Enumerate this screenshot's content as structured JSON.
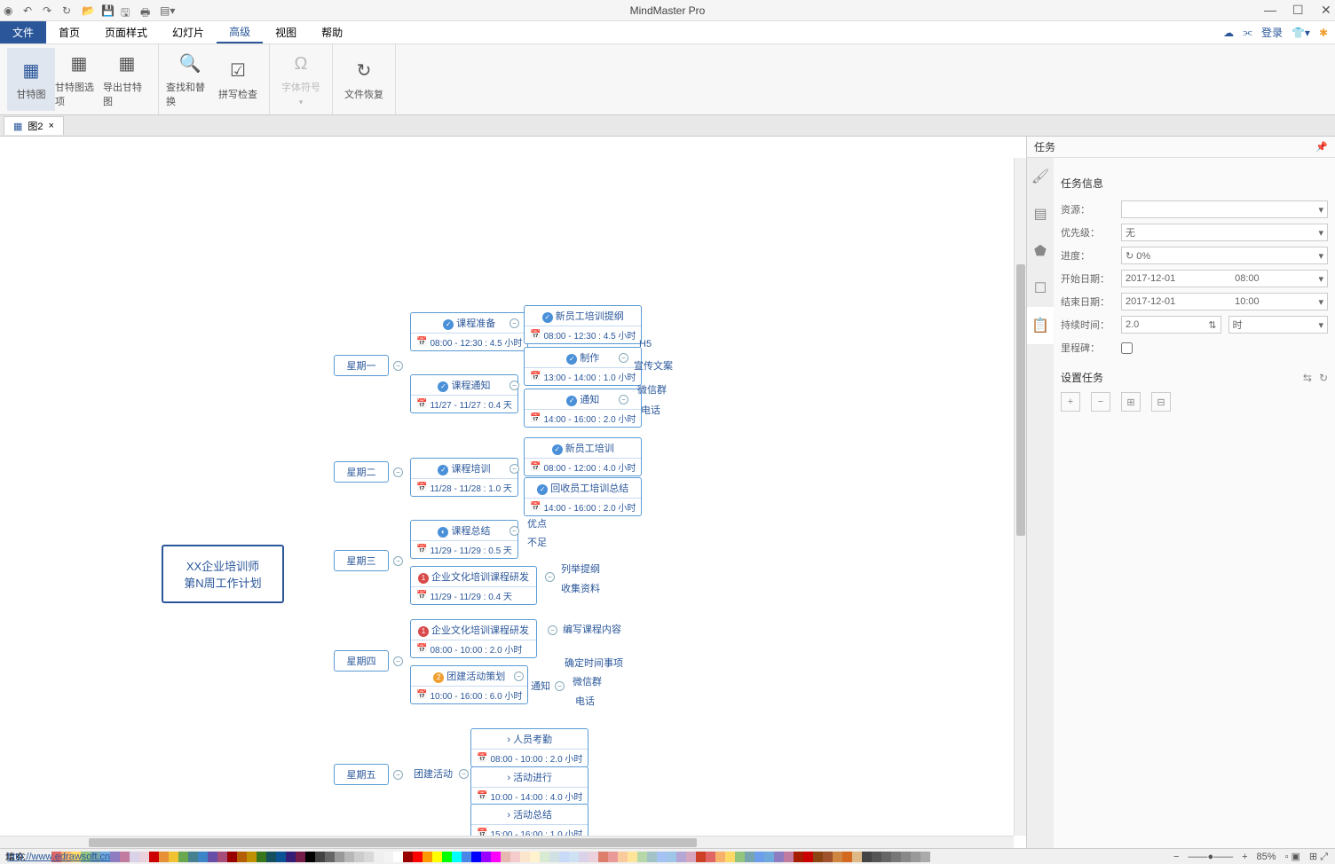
{
  "app_title": "MindMaster Pro",
  "qat": [
    "globe",
    "undo",
    "redo",
    "refresh",
    "open",
    "save2",
    "save",
    "print",
    "export"
  ],
  "menu": {
    "file": "文件",
    "items": [
      "首页",
      "页面样式",
      "幻灯片",
      "高级",
      "视图",
      "帮助"
    ],
    "active": 3,
    "login": "登录"
  },
  "ribbon": [
    {
      "label": "甘特图",
      "icon": "▦",
      "active": true
    },
    {
      "label": "甘特图选项",
      "icon": "▦"
    },
    {
      "label": "导出甘特图",
      "icon": "▦"
    },
    {
      "label": "查找和替换",
      "icon": "🔍"
    },
    {
      "label": "拼写检查",
      "icon": "☑"
    },
    {
      "label": "字体符号",
      "icon": "Ω",
      "disabled": true
    },
    {
      "label": "文件恢复",
      "icon": "↻"
    }
  ],
  "doc_tab": "图2",
  "panel": {
    "title": "任务",
    "section1": "任务信息",
    "section2": "设置任务",
    "rows": {
      "resource": {
        "label": "资源：",
        "value": ""
      },
      "priority": {
        "label": "优先级：",
        "value": "无"
      },
      "progress": {
        "label": "进度：",
        "value": "0%"
      },
      "start": {
        "label": "开始日期：",
        "date": "2017-12-01",
        "time": "08:00"
      },
      "end": {
        "label": "结束日期：",
        "date": "2017-12-01",
        "time": "10:00"
      },
      "duration": {
        "label": "持续时间：",
        "value": "2.0",
        "unit": "时"
      },
      "milestone": {
        "label": "里程碑："
      }
    }
  },
  "mindmap": {
    "root": {
      "l1": "XX企业培训师",
      "l2": "第N周工作计划"
    },
    "days": [
      "星期一",
      "星期二",
      "星期三",
      "星期四",
      "星期五"
    ],
    "mon": {
      "a": {
        "txt": "课程准备",
        "time": "08:00 - 12:30 : 4.5 小时"
      },
      "b": {
        "txt": "课程通知",
        "time": "11/27 - 11/27 : 0.4 天"
      },
      "c1": {
        "txt": "新员工培训提纲",
        "time": "08:00 - 12:30 : 4.5 小时"
      },
      "c2": {
        "txt": "制作",
        "time": "13:00 - 14:00 : 1.0 小时"
      },
      "c3": {
        "txt": "通知",
        "time": "14:00 - 16:00 : 2.0 小时"
      },
      "leaf": [
        "H5",
        "宣传文案",
        "微信群",
        "电话"
      ]
    },
    "tue": {
      "a": {
        "txt": "课程培训",
        "time": "11/28 - 11/28 : 1.0 天"
      },
      "c1": {
        "txt": "新员工培训",
        "time": "08:00 - 12:00 : 4.0 小时"
      },
      "c2": {
        "txt": "回收员工培训总结",
        "time": "14:00 - 16:00 : 2.0 小时"
      }
    },
    "wed": {
      "a": {
        "txt": "课程总结",
        "time": "11/29 - 11/29 : 0.5 天"
      },
      "b": {
        "txt": "企业文化培训课程研发",
        "time": "11/29 - 11/29 : 0.4 天"
      },
      "leaf": [
        "优点",
        "不足",
        "列举提纲",
        "收集资料"
      ]
    },
    "thu": {
      "a": {
        "txt": "企业文化培训课程研发",
        "time": "08:00 - 10:00 : 2.0 小时"
      },
      "b": {
        "txt": "团建活动策划",
        "time": "10:00 - 16:00 : 6.0 小时"
      },
      "leaf": [
        "编写课程内容",
        "确定时间事项",
        "微信群",
        "电话"
      ],
      "sub": "通知"
    },
    "fri": {
      "a": "团建活动",
      "c1": {
        "txt": "人员考勤",
        "time": "08:00 - 10:00 : 2.0 小时"
      },
      "c2": {
        "txt": "活动进行",
        "time": "10:00 - 14:00 : 4.0 小时"
      },
      "c3": {
        "txt": "活动总结",
        "time": "15:00 - 16:00 : 1.0 小时"
      }
    }
  },
  "status": {
    "fill_label": "填充",
    "zoom": "85%",
    "url": "http://www.edrawsoft.cn"
  },
  "swatches": [
    "#e06666",
    "#f6b26b",
    "#ffd966",
    "#93c47d",
    "#76a5af",
    "#6fa8dc",
    "#8e7cc3",
    "#c27ba0",
    "#d9d2e9",
    "#ead1dc",
    "#cc0000",
    "#e69138",
    "#f1c232",
    "#6aa84f",
    "#45818e",
    "#3d85c6",
    "#674ea7",
    "#a64d79",
    "#990000",
    "#b45f06",
    "#bf9000",
    "#38761d",
    "#134f5c",
    "#0b5394",
    "#351c75",
    "#741b47",
    "#000000",
    "#434343",
    "#666666",
    "#999999",
    "#b7b7b7",
    "#cccccc",
    "#d9d9d9",
    "#efefef",
    "#f3f3f3",
    "#ffffff",
    "#980000",
    "#ff0000",
    "#ff9900",
    "#ffff00",
    "#00ff00",
    "#00ffff",
    "#4a86e8",
    "#0000ff",
    "#9900ff",
    "#ff00ff",
    "#e6b8af",
    "#f4cccc",
    "#fce5cd",
    "#fff2cc",
    "#d9ead3",
    "#d0e0e3",
    "#c9daf8",
    "#cfe2f3",
    "#d9d2e9",
    "#ead1dc",
    "#dd7e6b",
    "#ea9999",
    "#f9cb9c",
    "#ffe599",
    "#b6d7a8",
    "#a2c4c9",
    "#a4c2f4",
    "#9fc5e8",
    "#b4a7d6",
    "#d5a6bd",
    "#cc4125",
    "#e06666",
    "#f6b26b",
    "#ffd966",
    "#93c47d",
    "#76a5af",
    "#6d9eeb",
    "#6fa8dc",
    "#8e7cc3",
    "#c27ba0",
    "#a61c00",
    "#cc0000",
    "#8B4513",
    "#A0522D",
    "#CD853F",
    "#D2691E",
    "#DEB887",
    "#444",
    "#555",
    "#666",
    "#777",
    "#888",
    "#999",
    "#aaa"
  ]
}
